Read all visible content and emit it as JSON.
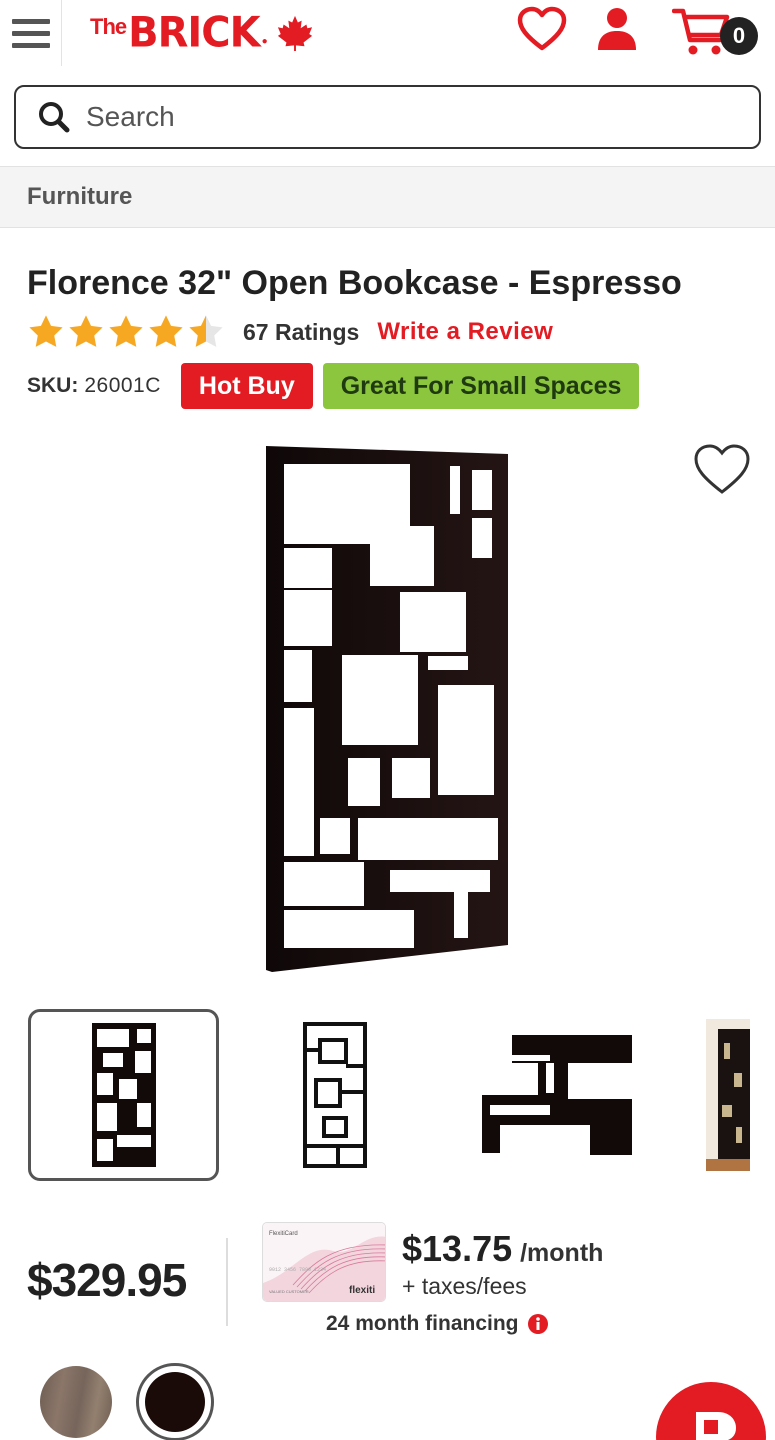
{
  "header": {
    "logo_the": "The",
    "logo_brick": "BRICK",
    "cart_count": "0"
  },
  "search": {
    "placeholder": "Search"
  },
  "breadcrumb": {
    "label": "Furniture"
  },
  "product": {
    "title": "Florence 32\" Open Bookcase - Espresso",
    "rating_value": 4.5,
    "rating_max": 5,
    "rating_count_label": "67 Ratings",
    "write_review_label": "Write a Review",
    "sku_label": "SKU:",
    "sku_value": "26001C",
    "badges": [
      "Hot Buy",
      "Great For Small Spaces"
    ]
  },
  "gallery": {
    "thumbnail_count": 4,
    "selected_index": 0
  },
  "pricing": {
    "price": "$329.95",
    "monthly_amount": "$13.75",
    "monthly_suffix": "/month",
    "taxes_note": "+ taxes/fees",
    "financing_label": "24 month financing",
    "card_brand": "flexiti",
    "card_title": "FlexitiCard",
    "card_number": "9012 3456 7890 1234",
    "card_holder": "VALUED CUSTOMER"
  },
  "swatches": [
    {
      "name": "Walnut",
      "color": "#7d6a5e"
    },
    {
      "name": "Espresso",
      "color": "#1a0b08",
      "selected": true
    }
  ],
  "colors": {
    "brand_red": "#e31b23",
    "badge_green": "#8cc63f",
    "star_gold": "#f7a823"
  }
}
